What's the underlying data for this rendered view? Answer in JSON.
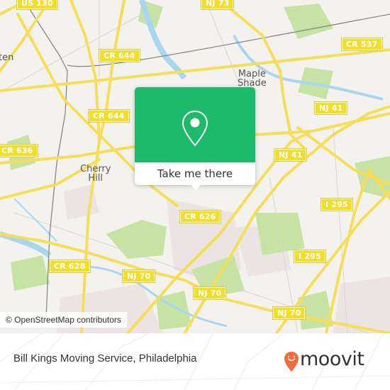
{
  "map": {
    "road_labels": [
      {
        "id": "us-130",
        "text": "US 130"
      },
      {
        "id": "nj-73",
        "text": "NJ 73"
      },
      {
        "id": "cr-644-top",
        "text": "CR 644"
      },
      {
        "id": "cr-537",
        "text": "CR 537"
      },
      {
        "id": "cr-644-mid",
        "text": "CR 644"
      },
      {
        "id": "cr-636",
        "text": "CR 636"
      },
      {
        "id": "nj-41-a",
        "text": "NJ 41"
      },
      {
        "id": "nj-41-b",
        "text": "NJ 41"
      },
      {
        "id": "i-295-a",
        "text": "I 295"
      },
      {
        "id": "cr-626",
        "text": "CR 626"
      },
      {
        "id": "i-295-b",
        "text": "I 295"
      },
      {
        "id": "cr-628",
        "text": "CR 628"
      },
      {
        "id": "nj-70-a",
        "text": "NJ 70"
      },
      {
        "id": "nj-70-b",
        "text": "NJ 70"
      },
      {
        "id": "nj-70-c",
        "text": "NJ 70"
      }
    ],
    "place_labels": [
      {
        "id": "maple-shade",
        "text": "Maple\nShade"
      },
      {
        "id": "cherry-hill",
        "text": "Cherry\nHill"
      },
      {
        "id": "partial-left",
        "text": "ten"
      }
    ],
    "colors": {
      "land": "#f3f2ee",
      "road": "#f7de5a",
      "park": "#c7e3a4",
      "water": "#a9d6ee",
      "urban": "#ebe4e2"
    }
  },
  "popup": {
    "icon": "map-pin-icon",
    "action_label": "Take me there",
    "color": "#1dba6c"
  },
  "attribution": "© OpenStreetMap contributors",
  "footer": {
    "title": "Bill Kings Moving Service, Philadelphia",
    "brand": "moovit",
    "brand_color": "#f26b3a"
  }
}
